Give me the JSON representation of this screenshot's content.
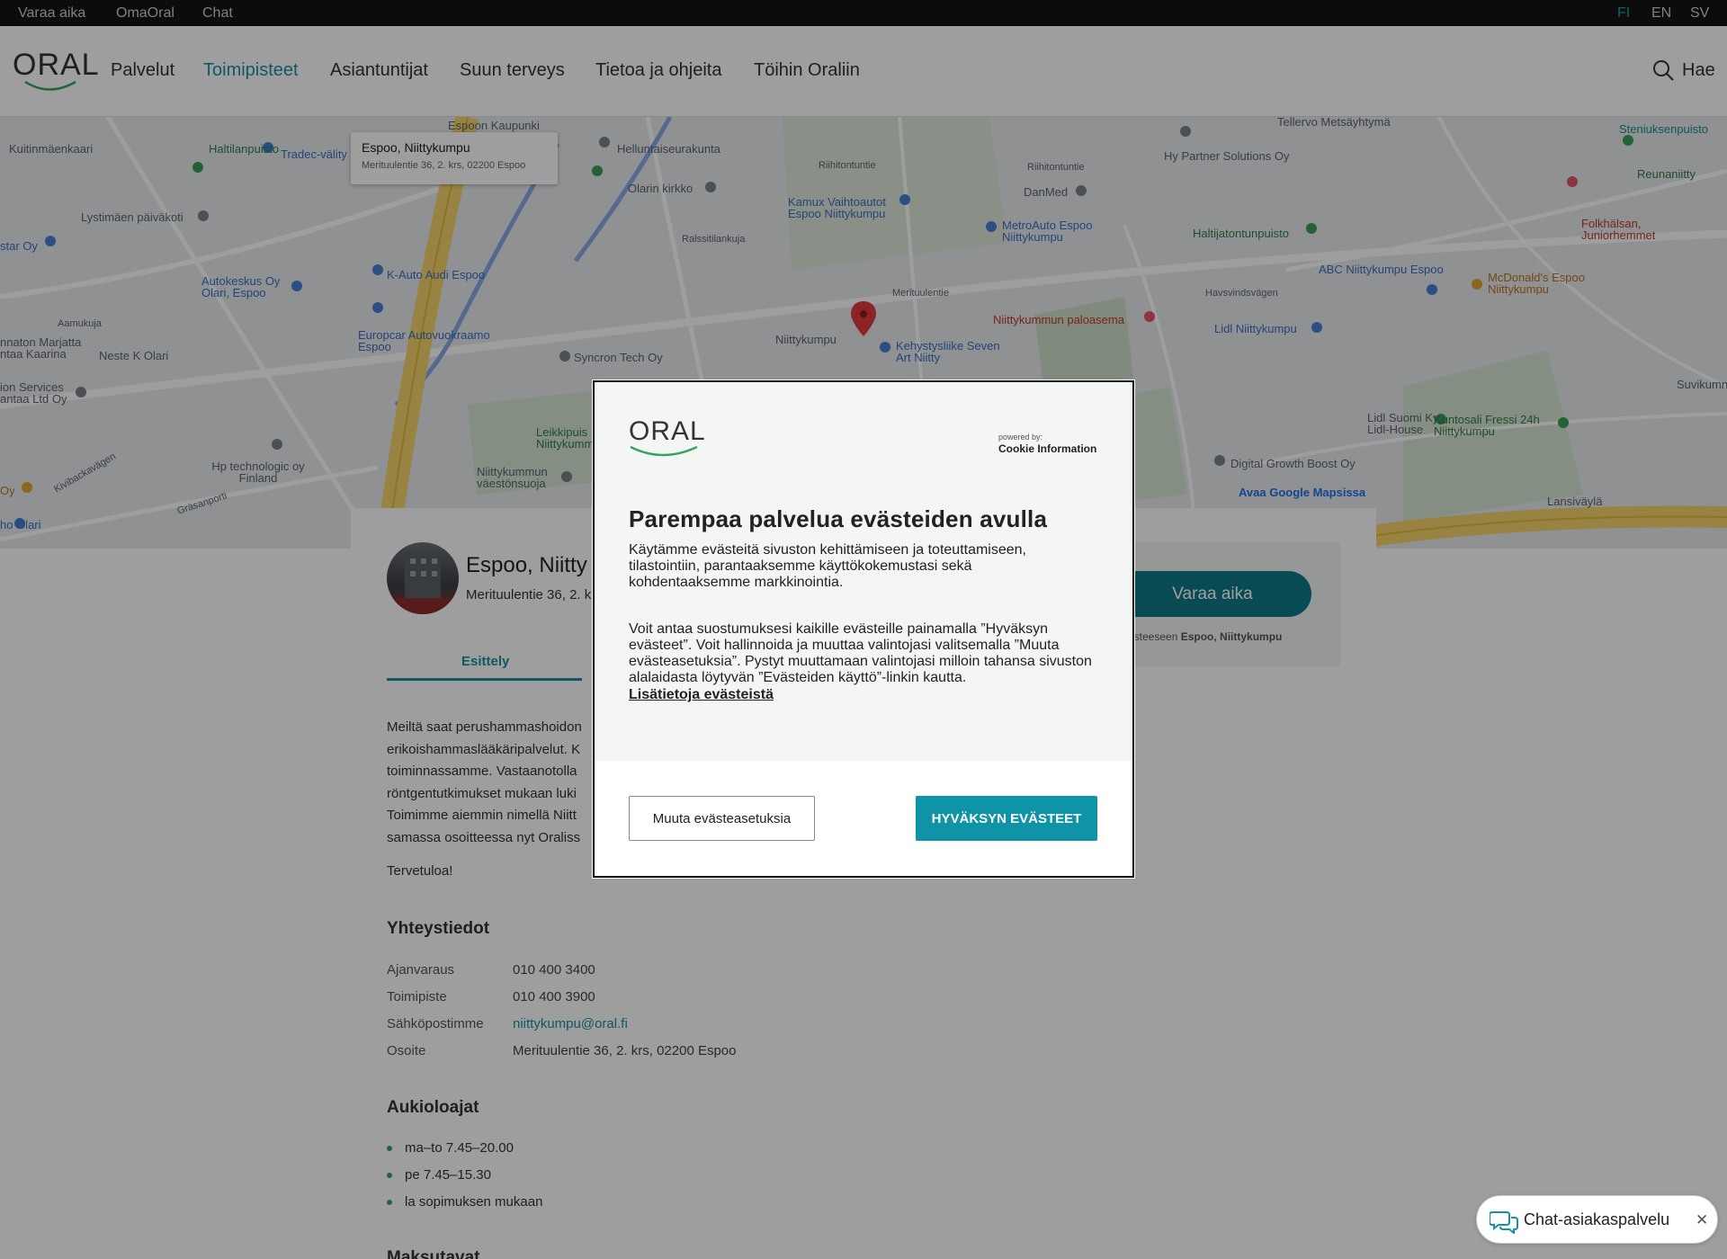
{
  "topbar": {
    "links": [
      "Varaa aika",
      "OmaOral",
      "Chat"
    ],
    "languages": [
      "FI",
      "EN",
      "SV"
    ],
    "active_language": "FI"
  },
  "header": {
    "logo": "ORAL",
    "nav": [
      "Palvelut",
      "Toimipisteet",
      "Asiantuntijat",
      "Suun terveys",
      "Tietoa ja ohjeita",
      "Töihin Oraliin"
    ],
    "active_nav": "Toimipisteet",
    "search_label": "Hae"
  },
  "map": {
    "card_title": "Espoo, Niittykumpu",
    "card_address": "Merituulentie 36, 2. krs, 02200 Espoo",
    "open_maps": "Avaa Google Mapsissa",
    "labels": {
      "l1": "Espoon Kaupunki",
      "l2": "Haltilanpuisto",
      "l3": "Tradec-välity",
      "l4": "Kuitinmäenkaari",
      "l5": "Lystimäen päiväkoti",
      "l6": "Helluntaiseurakunta",
      "l7": "Olarin kirkko",
      "l8": "Riihitontuntie",
      "l9": "Kamux Vaihtoautot Espoo Niittykumpu",
      "l10": "DanMed",
      "l11": "MetroAuto Espoo Niittykumpu",
      "l12": "Hy Partner Solutions Oy",
      "l13": "Tellervo Metsäyhtymä",
      "l14": "Steniuksenpuisto",
      "l15": "Reunaniitty",
      "l16": "Folkhälsan, Juniorhemmet",
      "l17": "Haltijatontunpuisto",
      "l18": "ABC Niittykumpu Espoo",
      "l19": "McDonald's Espoo Niittykumpu",
      "l20": "Havsvindsvägen",
      "l21": "Lidl Niittykumpu",
      "l22": "Niittykummun paloasema",
      "l23": "Merituulentie",
      "l24": "K-Auto Audi Espoo",
      "l25": "Autokeskus Oy Olari, Espoo",
      "l26": "Europcar Autovuokraamo Espoo",
      "l27": "Syncron Tech Oy",
      "l28": "Niittykumpu",
      "l29": "Kehystysliike Seven Art Niitty",
      "l30": "Aamukuja",
      "l31": "Neste K Olari",
      "l32": "nnaton Marjatta ntaa Kaarina",
      "l33": "ion Services antaa Ltd Oy",
      "l34": "Hp technologic oy Finland",
      "l35": "Leikkipuis Niittykummun",
      "l36": "Niittykummun väestönsuoja",
      "l37": "Lidl Suomi Ky, Lidl-House",
      "l38": "Kuntosali Fressi 24h Niittykumpu",
      "l39": "Digital Growth Boost Oy",
      "l40": "Suvikumn",
      "l41": "Lansiväylä",
      "l42": "star Oy",
      "l43": "ho Olari",
      "l44": "Kivibackavägen",
      "l45": "Gräsanporti",
      "l46": "Ralssitilankuja",
      "l47": "Riihitontuntie",
      "l48": "Oy"
    }
  },
  "location": {
    "title": "Espoo, Niitty",
    "address": "Merituulentie 36, 2. k",
    "tab": "Esittely",
    "intro_lines": [
      "Meiltä saat perushammashoidon",
      "erikoishammaslääkäripalvelut. K",
      "toiminnassamme. Vastaanotolla",
      "röntgentutkimukset mukaan luki",
      "Toimimme aiemmin nimellä Niitt",
      "samassa osoitteessa nyt Oraliss"
    ],
    "welcome": "Tervetuloa!",
    "contact_heading": "Yhteystiedot",
    "contacts": [
      {
        "k": "Ajanvaraus",
        "v": "010 400 3400"
      },
      {
        "k": "Toimipiste",
        "v": "010 400 3900"
      },
      {
        "k": "Sähköpostimme",
        "v": "niittykumpu@oral.fi"
      },
      {
        "k": "Osoite",
        "v": "Merituulentie 36, 2. krs, 02200 Espoo"
      }
    ],
    "hours_heading": "Aukioloajat",
    "hours": [
      "ma–to 7.45–20.00",
      "pe 7.45–15.30",
      "la sopimuksen mukaan"
    ],
    "next_heading": "Maksutavat",
    "book_button": "Varaa aika",
    "side_note_prefix": "isteeseen",
    "side_note_bold": "Espoo, Niittykumpu"
  },
  "cookie_modal": {
    "logo": "ORAL",
    "powered_by": "powered by:",
    "powered_name": "Cookie Information",
    "title": "Parempaa palvelua evästeiden avulla",
    "p1": "Käytämme evästeitä sivuston kehittämiseen ja toteuttamiseen, tilastointiin, parantaaksemme käyttökokemustasi sekä kohdentaaksemme markkinointia.",
    "p2": "Voit antaa suostumuksesi kaikille evästeille painamalla ”Hyväksyn evästeet”. Voit hallinnoida ja muuttaa valintojasi valitsemalla ”Muuta evästeasetuksia”. Pystyt muuttamaan valintojasi milloin tahansa sivuston alalaidasta löytyvän ”Evästeiden käyttö”-linkin kautta.",
    "link": "Lisätietoja evästeistä",
    "settings_button": "Muuta evästeasetuksia",
    "accept_button": "HYVÄKSYN EVÄSTEET"
  },
  "chat": {
    "label": "Chat-asiakaspalvelu"
  },
  "colors": {
    "brand_teal": "#0e94a6",
    "active_nav": "#1a8fa2"
  }
}
